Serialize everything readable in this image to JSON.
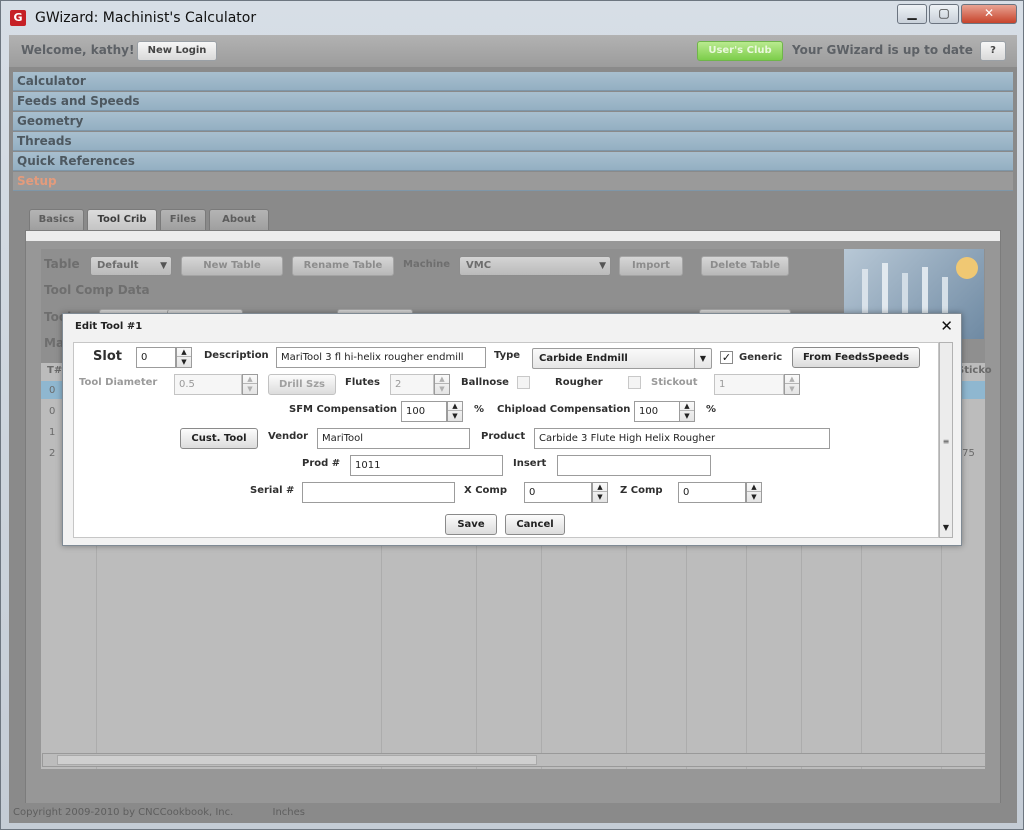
{
  "window": {
    "title": "GWizard: Machinist's Calculator",
    "minimize": "▁",
    "maximize": "▢",
    "close": "✕"
  },
  "topbar": {
    "welcome": "Welcome, kathy!",
    "new_login": "New Login",
    "users_club": "User's Club",
    "status": "Your GWizard is up to date",
    "help": "?"
  },
  "nav": [
    "Calculator",
    "Feeds and Speeds",
    "Geometry",
    "Threads",
    "Quick References",
    "Setup"
  ],
  "tabs": [
    "Basics",
    "Tool Crib",
    "Files",
    "About"
  ],
  "toolcrib": {
    "table_label": "Table",
    "table_value": "Default",
    "new_table": "New Table",
    "rename_table": "Rename Table",
    "machine_label": "Machine",
    "machine_value": "VMC",
    "import": "Import",
    "delete_table": "Delete Table",
    "tool_comp_data": "Tool Comp Data",
    "tools_label": "Tools",
    "new_tool": "New Tool",
    "edit_tool": "Edit Tool",
    "move_tool": "Move Tool",
    "del_tool": "Del Tool",
    "max_label": "Max",
    "grid_header_first": "T#",
    "grid_header_last": "Sticko",
    "grid_rows": [
      "0",
      "0",
      "1",
      "2"
    ],
    "grid_last_cell": ".75"
  },
  "dialog": {
    "title": "Edit Tool #1",
    "close": "✕",
    "slot_label": "Slot",
    "slot_value": "0",
    "description_label": "Description",
    "description_value": "MariTool 3 fl hi-helix rougher endmill",
    "type_label": "Type",
    "type_value": "Carbide Endmill",
    "generic_label": "Generic",
    "generic_checked": "✓",
    "from_feedsspeeds": "From FeedsSpeeds",
    "tool_diameter_label": "Tool Diameter",
    "tool_diameter_value": "0.5",
    "drill_szs": "Drill Szs",
    "flutes_label": "Flutes",
    "flutes_value": "2",
    "ballnose_label": "Ballnose",
    "rougher_label": "Rougher",
    "stickout_label": "Stickout",
    "stickout_value": "1",
    "sfm_label": "SFM Compensation",
    "sfm_value": "100",
    "sfm_unit": "%",
    "chipload_label": "Chipload Compensation",
    "chipload_value": "100",
    "chipload_unit": "%",
    "cust_tool": "Cust. Tool",
    "vendor_label": "Vendor",
    "vendor_value": "MariTool",
    "product_label": "Product",
    "product_value": "Carbide 3 Flute High Helix Rougher",
    "prod_label": "Prod #",
    "prod_value": "1011",
    "insert_label": "Insert",
    "insert_value": "",
    "serial_label": "Serial #",
    "serial_value": "",
    "xcomp_label": "X Comp",
    "xcomp_value": "0",
    "zcomp_label": "Z Comp",
    "zcomp_value": "0",
    "save": "Save",
    "cancel": "Cancel"
  },
  "footer": {
    "copyright": "Copyright 2009-2010 by CNCCookbook, Inc.",
    "units": "Inches"
  }
}
